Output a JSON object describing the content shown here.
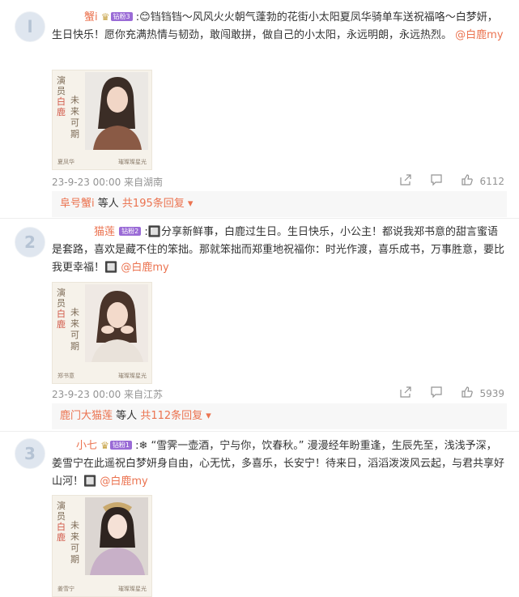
{
  "comments": [
    {
      "avatar_initial": "l",
      "name": "蟹i",
      "badge": "钻粉3",
      "body": ":😊铛铛铛～风风火火朝气蓬勃的花街小太阳夏凤华骑单车送祝福咯～白梦妍，生日快乐！愿你充满热情与韧劲，敢闯敢拼，做自己的小太阳，永远明朗，永远热烈。",
      "mention": "@白鹿my",
      "poster": {
        "title_top": "演员",
        "title_name": "白鹿",
        "slogan": "未来可期",
        "role": "夏凤华",
        "brand": "璀璨璨星光"
      },
      "time": "23-9-23 00:00 来自湖南",
      "likes": "6112",
      "reply_names": "阜号蟹i",
      "reply_sep": "等人",
      "reply_link": "共195条回复",
      "reply_arrow": "▾"
    },
    {
      "avatar_initial": "2",
      "name": "猫莲",
      "badge": "钻粉2",
      "body": ":🔲分享新鲜事，白鹿过生日。生日快乐，小公主！都说我郑书意的甜言蜜语是套路，喜欢是藏不住的笨拙。那就笨拙而郑重地祝福你：时光作渡，喜乐成书，万事胜意，要比我更幸福！🔲",
      "mention": "@白鹿my",
      "poster": {
        "title_top": "演员",
        "title_name": "白鹿",
        "slogan": "未来可期",
        "role": "郑书意",
        "brand": "璀璨璨星光"
      },
      "time": "23-9-23 00:00 来自江苏",
      "likes": "5939",
      "reply_names": "鹿门大猫莲",
      "reply_sep": "等人",
      "reply_link": "共112条回复",
      "reply_arrow": "▾"
    },
    {
      "avatar_initial": "3",
      "name": "小七",
      "badge": "钻粉1",
      "body": ":❄ “雪霁一壶酒，宁与你，饮春秋。” 漫漫经年盼重逢，生辰先至，浅浅予深，姜雪宁在此遥祝白梦妍身自由，心无忧，多喜乐，长安宁！待来日，滔滔泼泼风云起，与君共享好山河！🔲",
      "mention": "@白鹿my",
      "poster": {
        "title_top": "演员",
        "title_name": "白鹿",
        "slogan": "未来可期",
        "role": "姜雪宁",
        "brand": "璀璨璨星光"
      },
      "time": "",
      "likes": "",
      "reply_names": "",
      "reply_sep": "",
      "reply_link": "",
      "reply_arrow": ""
    }
  ],
  "icons": {
    "share": "share-icon",
    "comment": "comment-icon",
    "like": "like-icon"
  },
  "colors": {
    "accent": "#eb7350",
    "meta": "#939393",
    "badge": "#9a6bd6"
  }
}
